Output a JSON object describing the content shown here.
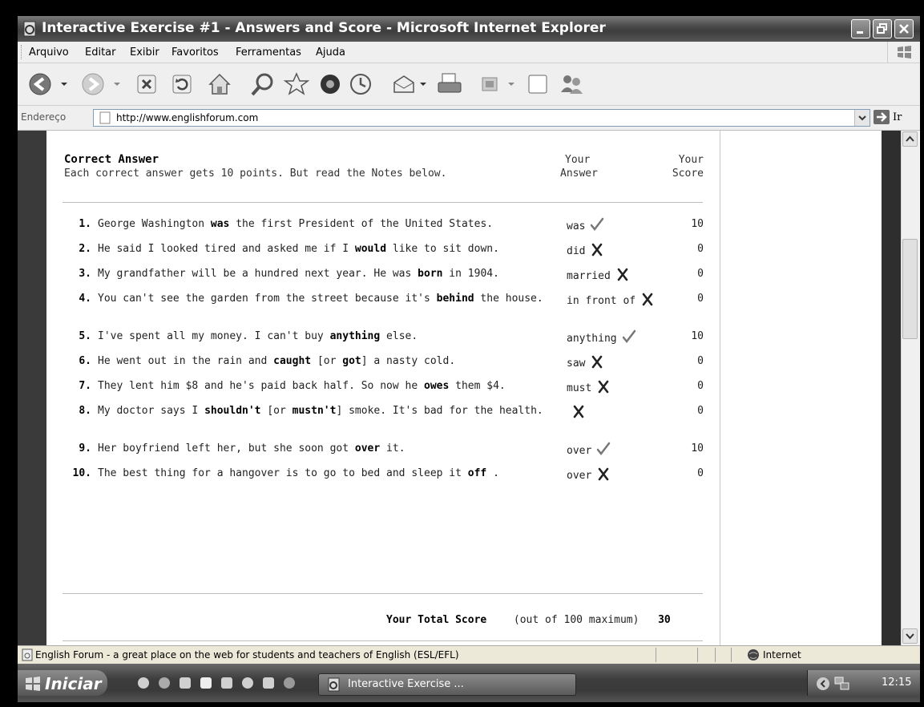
{
  "window": {
    "title": "Interactive Exercise #1 - Answers and Score - Microsoft Internet Explorer"
  },
  "menu": [
    "Arquivo",
    "Editar",
    "Exibir",
    "Favoritos",
    "Ferramentas",
    "Ajuda"
  ],
  "address": {
    "label": "Endereço",
    "url": "http://www.englishforum.com",
    "go_label": "Ir"
  },
  "header": {
    "title": "Correct Answer",
    "subtitle": "Each correct answer gets 10 points. But read the Notes below.",
    "col_answer_1": "Your",
    "col_answer_2": "Answer",
    "col_score_1": "Your",
    "col_score_2": "Score"
  },
  "rows": [
    {
      "num": "1.",
      "parts": [
        {
          "t": "George Washington "
        },
        {
          "t": "was",
          "b": true
        },
        {
          "t": " the first President of the United States."
        }
      ],
      "answer": "was",
      "mark": "check",
      "score": "10"
    },
    {
      "num": "2.",
      "parts": [
        {
          "t": "He said I looked tired and asked me if I "
        },
        {
          "t": "would",
          "b": true
        },
        {
          "t": " like to sit down."
        }
      ],
      "answer": "did",
      "mark": "cross",
      "score": "0"
    },
    {
      "num": "3.",
      "parts": [
        {
          "t": "My grandfather will be a hundred next year. He was "
        },
        {
          "t": "born",
          "b": true
        },
        {
          "t": " in 1904."
        }
      ],
      "answer": "married",
      "mark": "cross",
      "score": "0"
    },
    {
      "num": "4.",
      "parts": [
        {
          "t": "You can't see the garden from the street because it's "
        },
        {
          "t": "behind",
          "b": true
        },
        {
          "t": " the house."
        }
      ],
      "answer": "in front of",
      "mark": "cross",
      "score": "0"
    },
    {
      "num": "5.",
      "parts": [
        {
          "t": "I've spent all my money. I can't buy "
        },
        {
          "t": "anything",
          "b": true
        },
        {
          "t": " else."
        }
      ],
      "answer": "anything",
      "mark": "check",
      "score": "10"
    },
    {
      "num": "6.",
      "parts": [
        {
          "t": "He went out in the rain and "
        },
        {
          "t": "caught",
          "b": true
        },
        {
          "t": " [or "
        },
        {
          "t": "got",
          "b": true
        },
        {
          "t": "] a nasty cold."
        }
      ],
      "answer": "saw",
      "mark": "cross",
      "score": "0"
    },
    {
      "num": "7.",
      "parts": [
        {
          "t": "They lent him $8 and he's paid back half. So now he "
        },
        {
          "t": "owes",
          "b": true
        },
        {
          "t": " them $4."
        }
      ],
      "answer": "must",
      "mark": "cross",
      "score": "0"
    },
    {
      "num": "8.",
      "parts": [
        {
          "t": "My doctor says I "
        },
        {
          "t": "shouldn't",
          "b": true
        },
        {
          "t": " [or "
        },
        {
          "t": "mustn't",
          "b": true
        },
        {
          "t": "] smoke. It's bad for the health."
        }
      ],
      "answer": "",
      "mark": "cross",
      "score": "0"
    },
    {
      "num": "9.",
      "parts": [
        {
          "t": "Her boyfriend left her, but she soon got "
        },
        {
          "t": "over",
          "b": true
        },
        {
          "t": " it."
        }
      ],
      "answer": "over",
      "mark": "check",
      "score": "10"
    },
    {
      "num": "10.",
      "parts": [
        {
          "t": "The best thing for a hangover is to go to bed and sleep it "
        },
        {
          "t": "off",
          "b": true
        },
        {
          "t": " ."
        }
      ],
      "answer": "over",
      "mark": "cross",
      "score": "0"
    }
  ],
  "total": {
    "label": "Your Total Score",
    "note": "(out of 100 maximum)",
    "value": "30"
  },
  "status": {
    "text": "English Forum - a great place on the web for students and teachers of English (ESL/EFL)",
    "zone": "Internet"
  },
  "taskbar": {
    "start": "Iniciar",
    "task": "Interactive Exercise ...",
    "clock": "12:15"
  },
  "colors": {
    "titlebar": "#4a4a4a",
    "check": "#777777",
    "cross": "#222222"
  }
}
